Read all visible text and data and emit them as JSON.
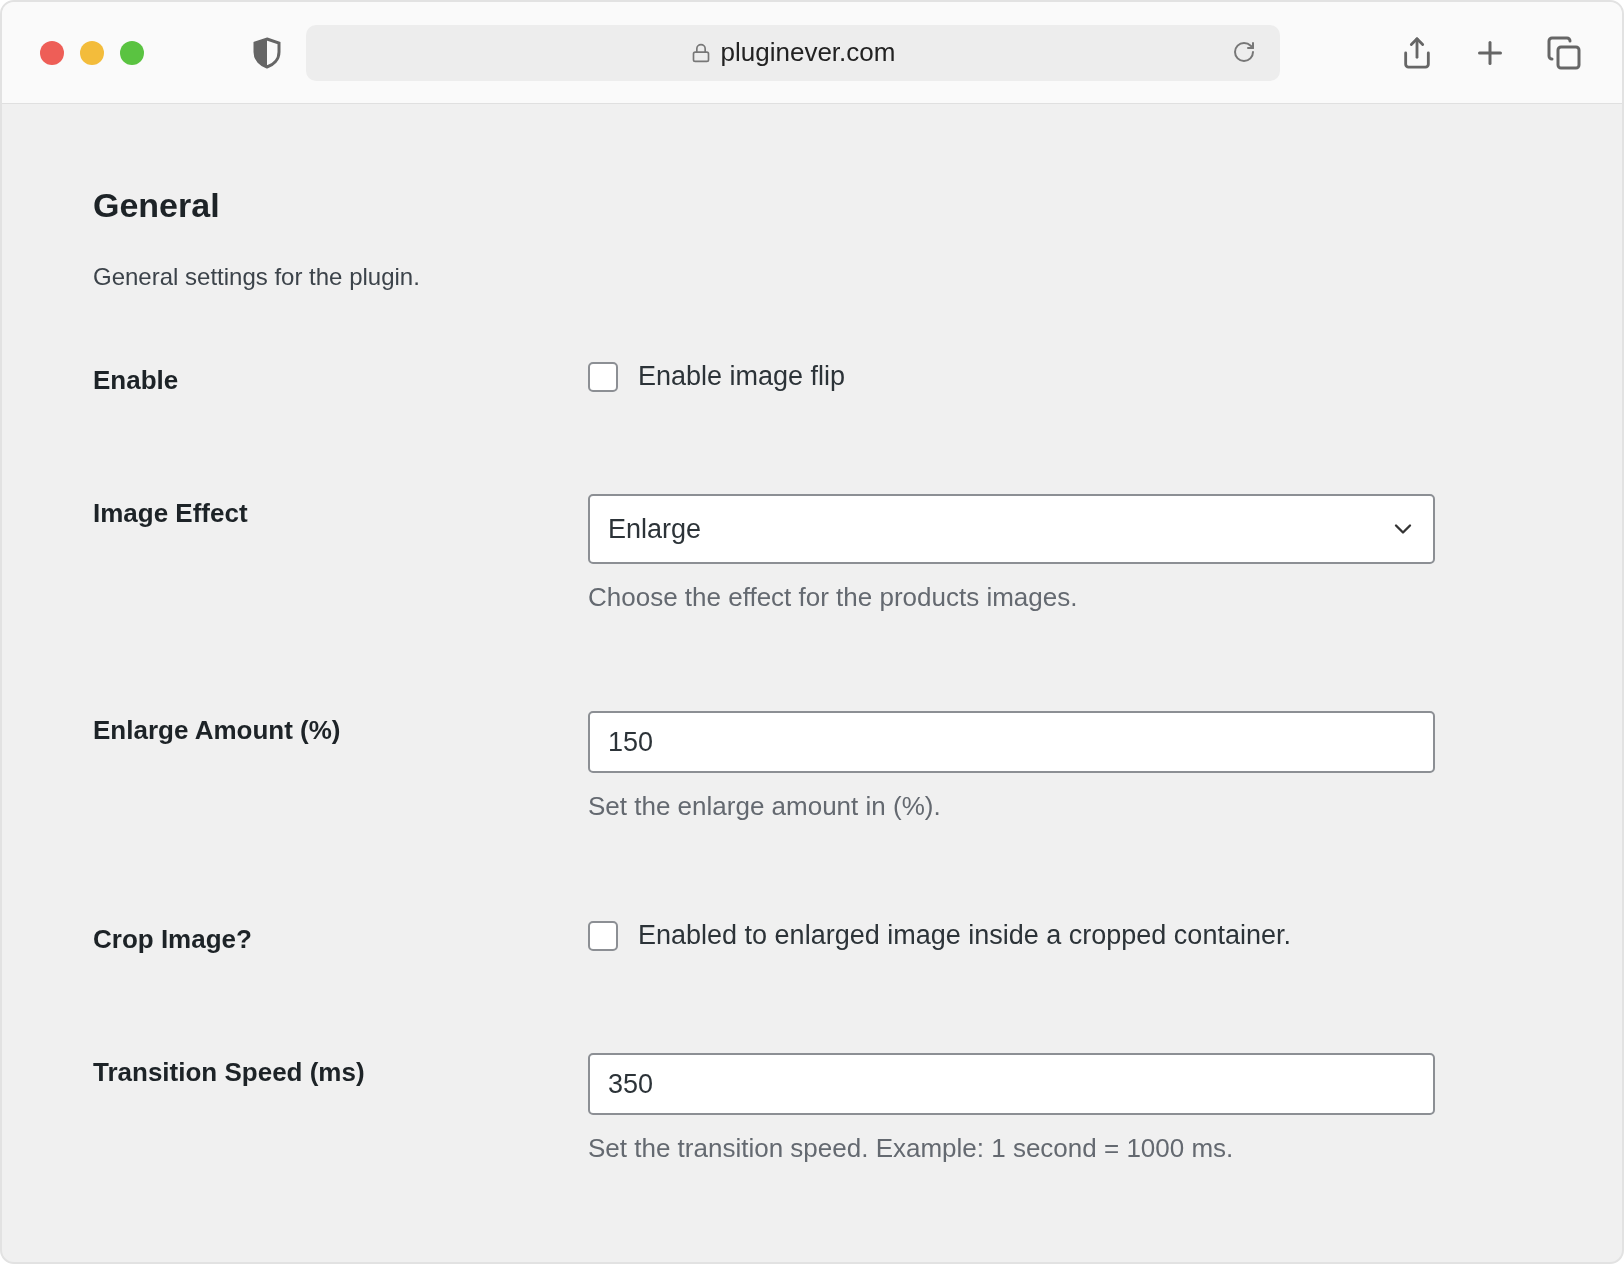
{
  "browser": {
    "url": "pluginever.com"
  },
  "section": {
    "title": "General",
    "description": "General settings for the plugin."
  },
  "fields": [
    {
      "kind": "checkbox",
      "label": "Enable",
      "checked": false,
      "text": "Enable image flip"
    },
    {
      "kind": "select",
      "label": "Image Effect",
      "value": "Enlarge",
      "hint": "Choose the effect for the products images."
    },
    {
      "kind": "input",
      "label": "Enlarge Amount (%)",
      "value": "150",
      "hint": "Set the enlarge amount in (%)."
    },
    {
      "kind": "checkbox",
      "label": "Crop Image?",
      "checked": false,
      "text": "Enabled to enlarged image inside a cropped container."
    },
    {
      "kind": "input",
      "label": "Transition Speed (ms)",
      "value": "350",
      "hint": "Set the transition speed. Example: 1 second = 1000 ms."
    }
  ]
}
